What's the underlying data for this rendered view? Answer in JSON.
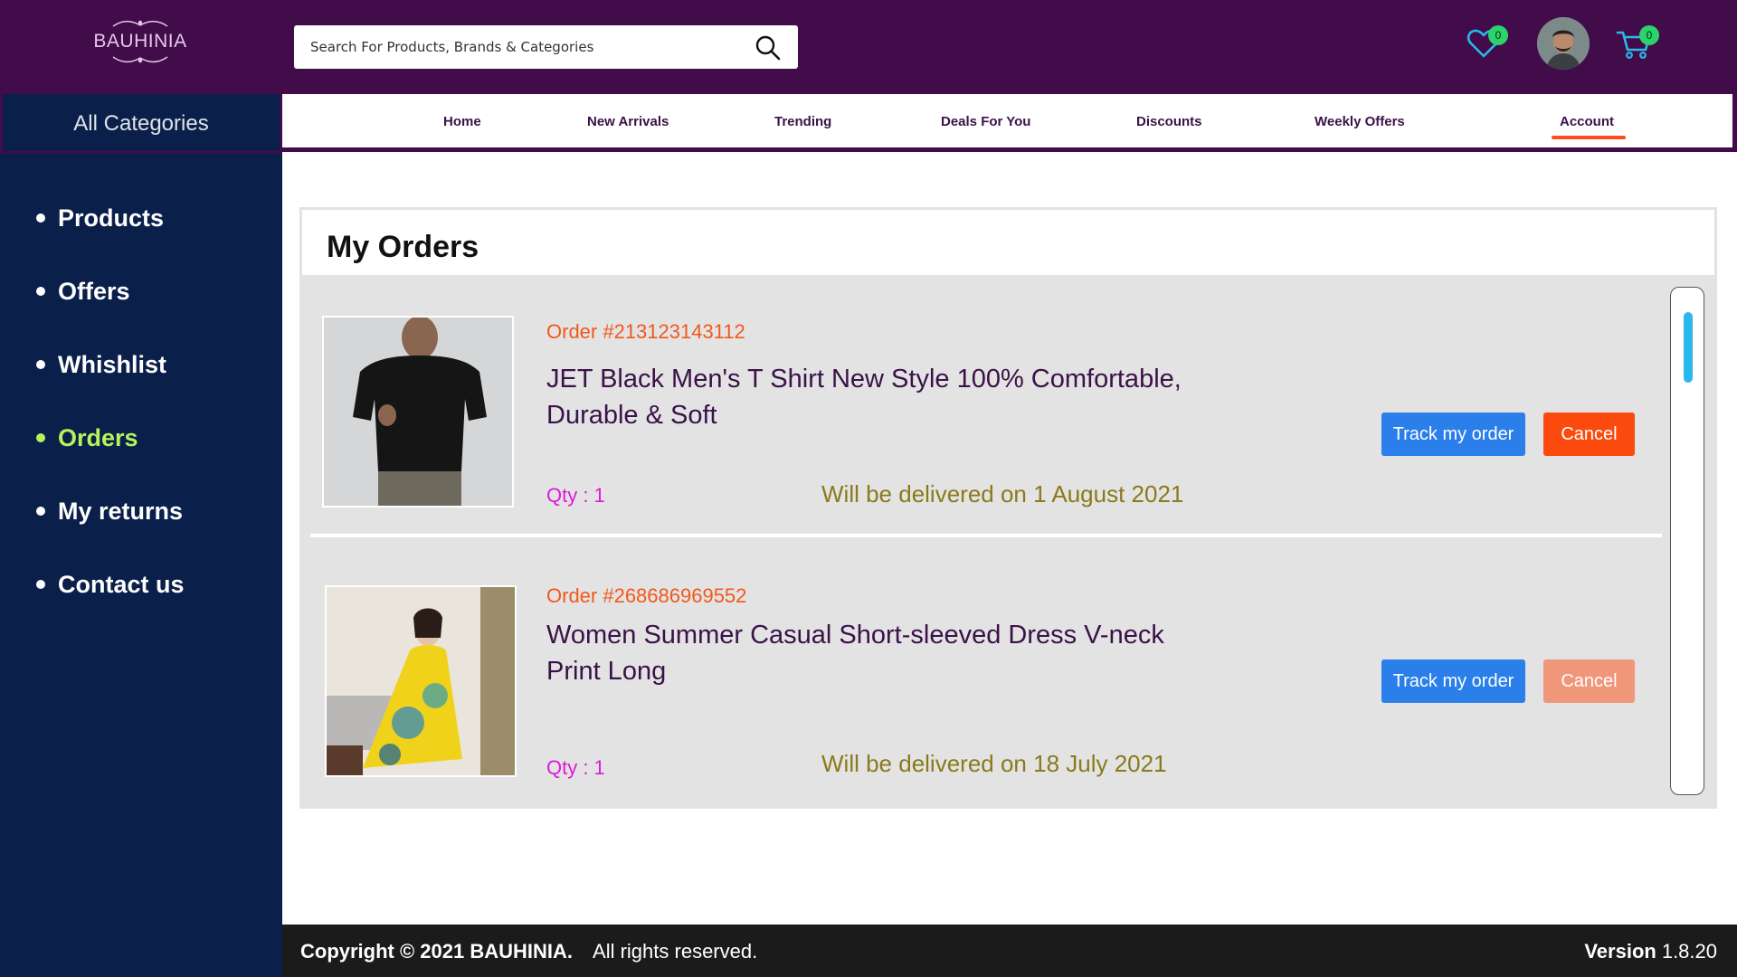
{
  "brand": {
    "name": "BAUHINIA"
  },
  "search": {
    "placeholder": "Search For Products, Brands & Categories",
    "icon": "search-icon"
  },
  "header": {
    "wishlist_count": "0",
    "cart_count": "0",
    "icons": {
      "wishlist": "heart-icon",
      "cart": "cart-icon",
      "profile": "avatar"
    }
  },
  "sidebar": {
    "all_categories": "All Categories",
    "items": [
      {
        "label": "Products",
        "active": false
      },
      {
        "label": "Offers",
        "active": false
      },
      {
        "label": "Whishlist",
        "active": false
      },
      {
        "label": "Orders",
        "active": true
      },
      {
        "label": "My returns",
        "active": false
      },
      {
        "label": "Contact us",
        "active": false
      }
    ]
  },
  "nav": {
    "items": [
      "Home",
      "New Arrivals",
      "Trending",
      "Deals For You",
      "Discounts",
      "Weekly Offers",
      "Account"
    ],
    "active": "Account"
  },
  "orders": {
    "heading": "My Orders",
    "list": [
      {
        "order_no": "Order #213123143112",
        "title": "JET Black Men's T Shirt New Style 100% Comfortable, Durable & Soft",
        "qty": "Qty : 1",
        "delivery": "Will be delivered on 1 August 2021",
        "track_label": "Track my order",
        "cancel_label": "Cancel",
        "cancel_enabled": true
      },
      {
        "order_no": "Order #268686969552",
        "title": "Women Summer Casual Short-sleeved Dress V-neck Print Long",
        "qty": "Qty : 1",
        "delivery": "Will be delivered on 18 July 2021",
        "track_label": "Track my order",
        "cancel_label": "Cancel",
        "cancel_enabled": false
      }
    ]
  },
  "footer": {
    "copyright": "Copyright  ©  2021  BAUHINIA.",
    "rights": "All rights reserved.",
    "version_label": "Version",
    "version": "1.8.20"
  },
  "colors": {
    "header_bg": "#420c4a",
    "sidebar_bg": "#0a1f4a",
    "active_green": "#b6f25a",
    "accent_orange": "#fb4a0e",
    "track_blue": "#2a7fea",
    "badge_green": "#2bd36b"
  }
}
